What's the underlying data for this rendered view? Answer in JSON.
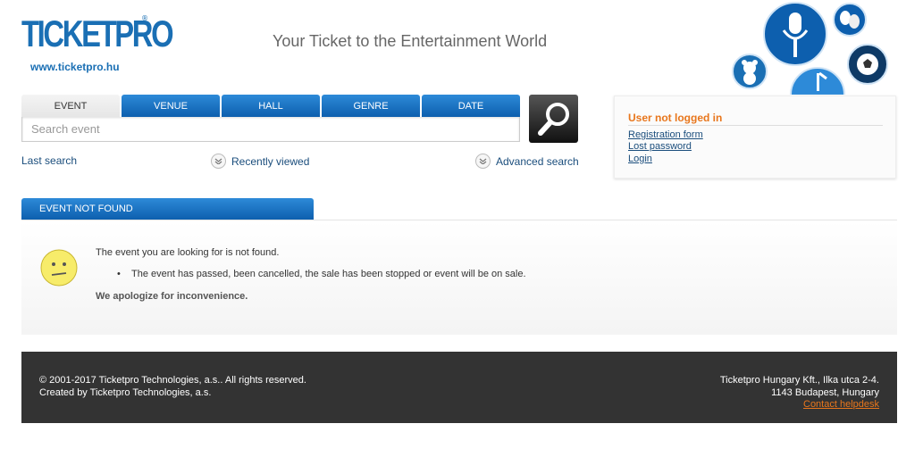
{
  "header": {
    "logo_text": "TICKETPRO",
    "logo_reg": "®",
    "logo_url": "www.ticketpro.hu",
    "tagline": "Your Ticket to the Entertainment World",
    "category_icons": [
      "microphone-icon",
      "theater-masks-icon",
      "teddy-bear-icon",
      "football-icon",
      "music-note-icon"
    ]
  },
  "search": {
    "tabs": [
      "EVENT",
      "VENUE",
      "HALL",
      "GENRE",
      "DATE"
    ],
    "active_tab": "EVENT",
    "placeholder": "Search event",
    "value": "",
    "last_search": "Last search",
    "recently_viewed": "Recently viewed",
    "advanced_search": "Advanced search"
  },
  "login": {
    "title": "User not logged in",
    "registration": "Registration form",
    "lost_password": "Lost password",
    "login": "Login"
  },
  "panel": {
    "title": "EVENT NOT FOUND",
    "message": "The event you are looking for is not found.",
    "reason": "The event has passed, been cancelled, the sale has been stopped or event will be on sale.",
    "apology": "We apologize for inconvenience."
  },
  "footer": {
    "copyright": "© 2001-2017 Ticketpro Technologies, a.s.. All rights reserved.",
    "created_by": "Created by Ticketpro Technologies, a.s.",
    "company": "Ticketpro Hungary Kft., Ilka utca 2-4.",
    "city": "1143 Budapest, Hungary",
    "helpdesk": "Contact helpdesk"
  },
  "colors": {
    "brand_blue": "#1a6fb4",
    "tab_blue": "#0d5fae",
    "accent_orange": "#e8761c",
    "footer_bg": "#333333"
  }
}
